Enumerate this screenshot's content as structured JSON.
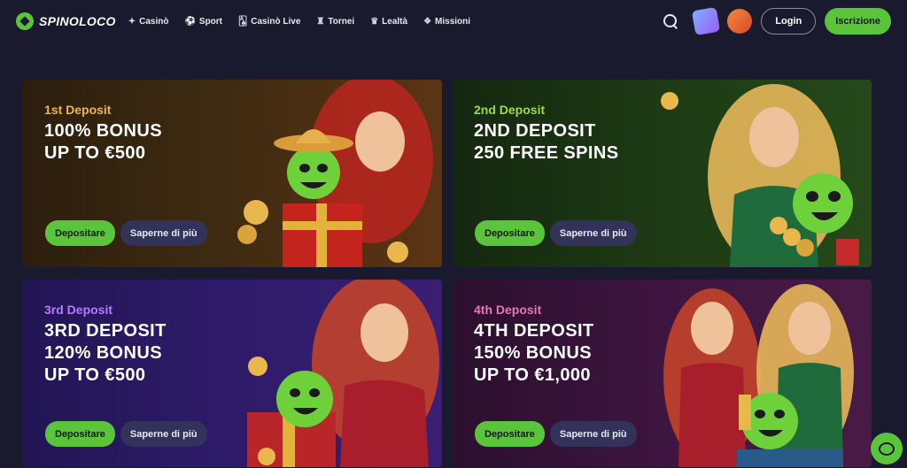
{
  "brand": {
    "name": "SPINOLOCO"
  },
  "nav": [
    {
      "label": "Casinò",
      "icon": "diamond-icon",
      "glyph": "✦"
    },
    {
      "label": "Sport",
      "icon": "ball-icon",
      "glyph": "⚽"
    },
    {
      "label": "Casinò Live",
      "icon": "cards-icon",
      "glyph": "🂡"
    },
    {
      "label": "Tornei",
      "icon": "trophy-icon",
      "glyph": "♜"
    },
    {
      "label": "Lealtà",
      "icon": "crown-icon",
      "glyph": "♛"
    },
    {
      "label": "Missioni",
      "icon": "mission-icon",
      "glyph": "❖"
    }
  ],
  "header": {
    "login_label": "Login",
    "signup_label": "Iscrizione"
  },
  "cards": [
    {
      "subtitle": "1st Deposit",
      "line1": "100% BONUS",
      "line2": "UP TO €500",
      "line3": "",
      "deposit_label": "Depositare",
      "more_label": "Saperne di più"
    },
    {
      "subtitle": "2nd Deposit",
      "line1": "2ND DEPOSIT",
      "line2": "250 FREE SPINS",
      "line3": "",
      "deposit_label": "Depositare",
      "more_label": "Saperne di più"
    },
    {
      "subtitle": "3rd Deposit",
      "line1": "3RD DEPOSIT",
      "line2": "120% BONUS",
      "line3": "UP TO €500",
      "deposit_label": "Depositare",
      "more_label": "Saperne di più"
    },
    {
      "subtitle": "4th Deposit",
      "line1": "4TH DEPOSIT",
      "line2": "150% BONUS",
      "line3": "UP TO €1,000",
      "deposit_label": "Depositare",
      "more_label": "Saperne di più"
    }
  ],
  "colors": {
    "accent": "#5ac43a",
    "background": "#1a1a2e"
  }
}
